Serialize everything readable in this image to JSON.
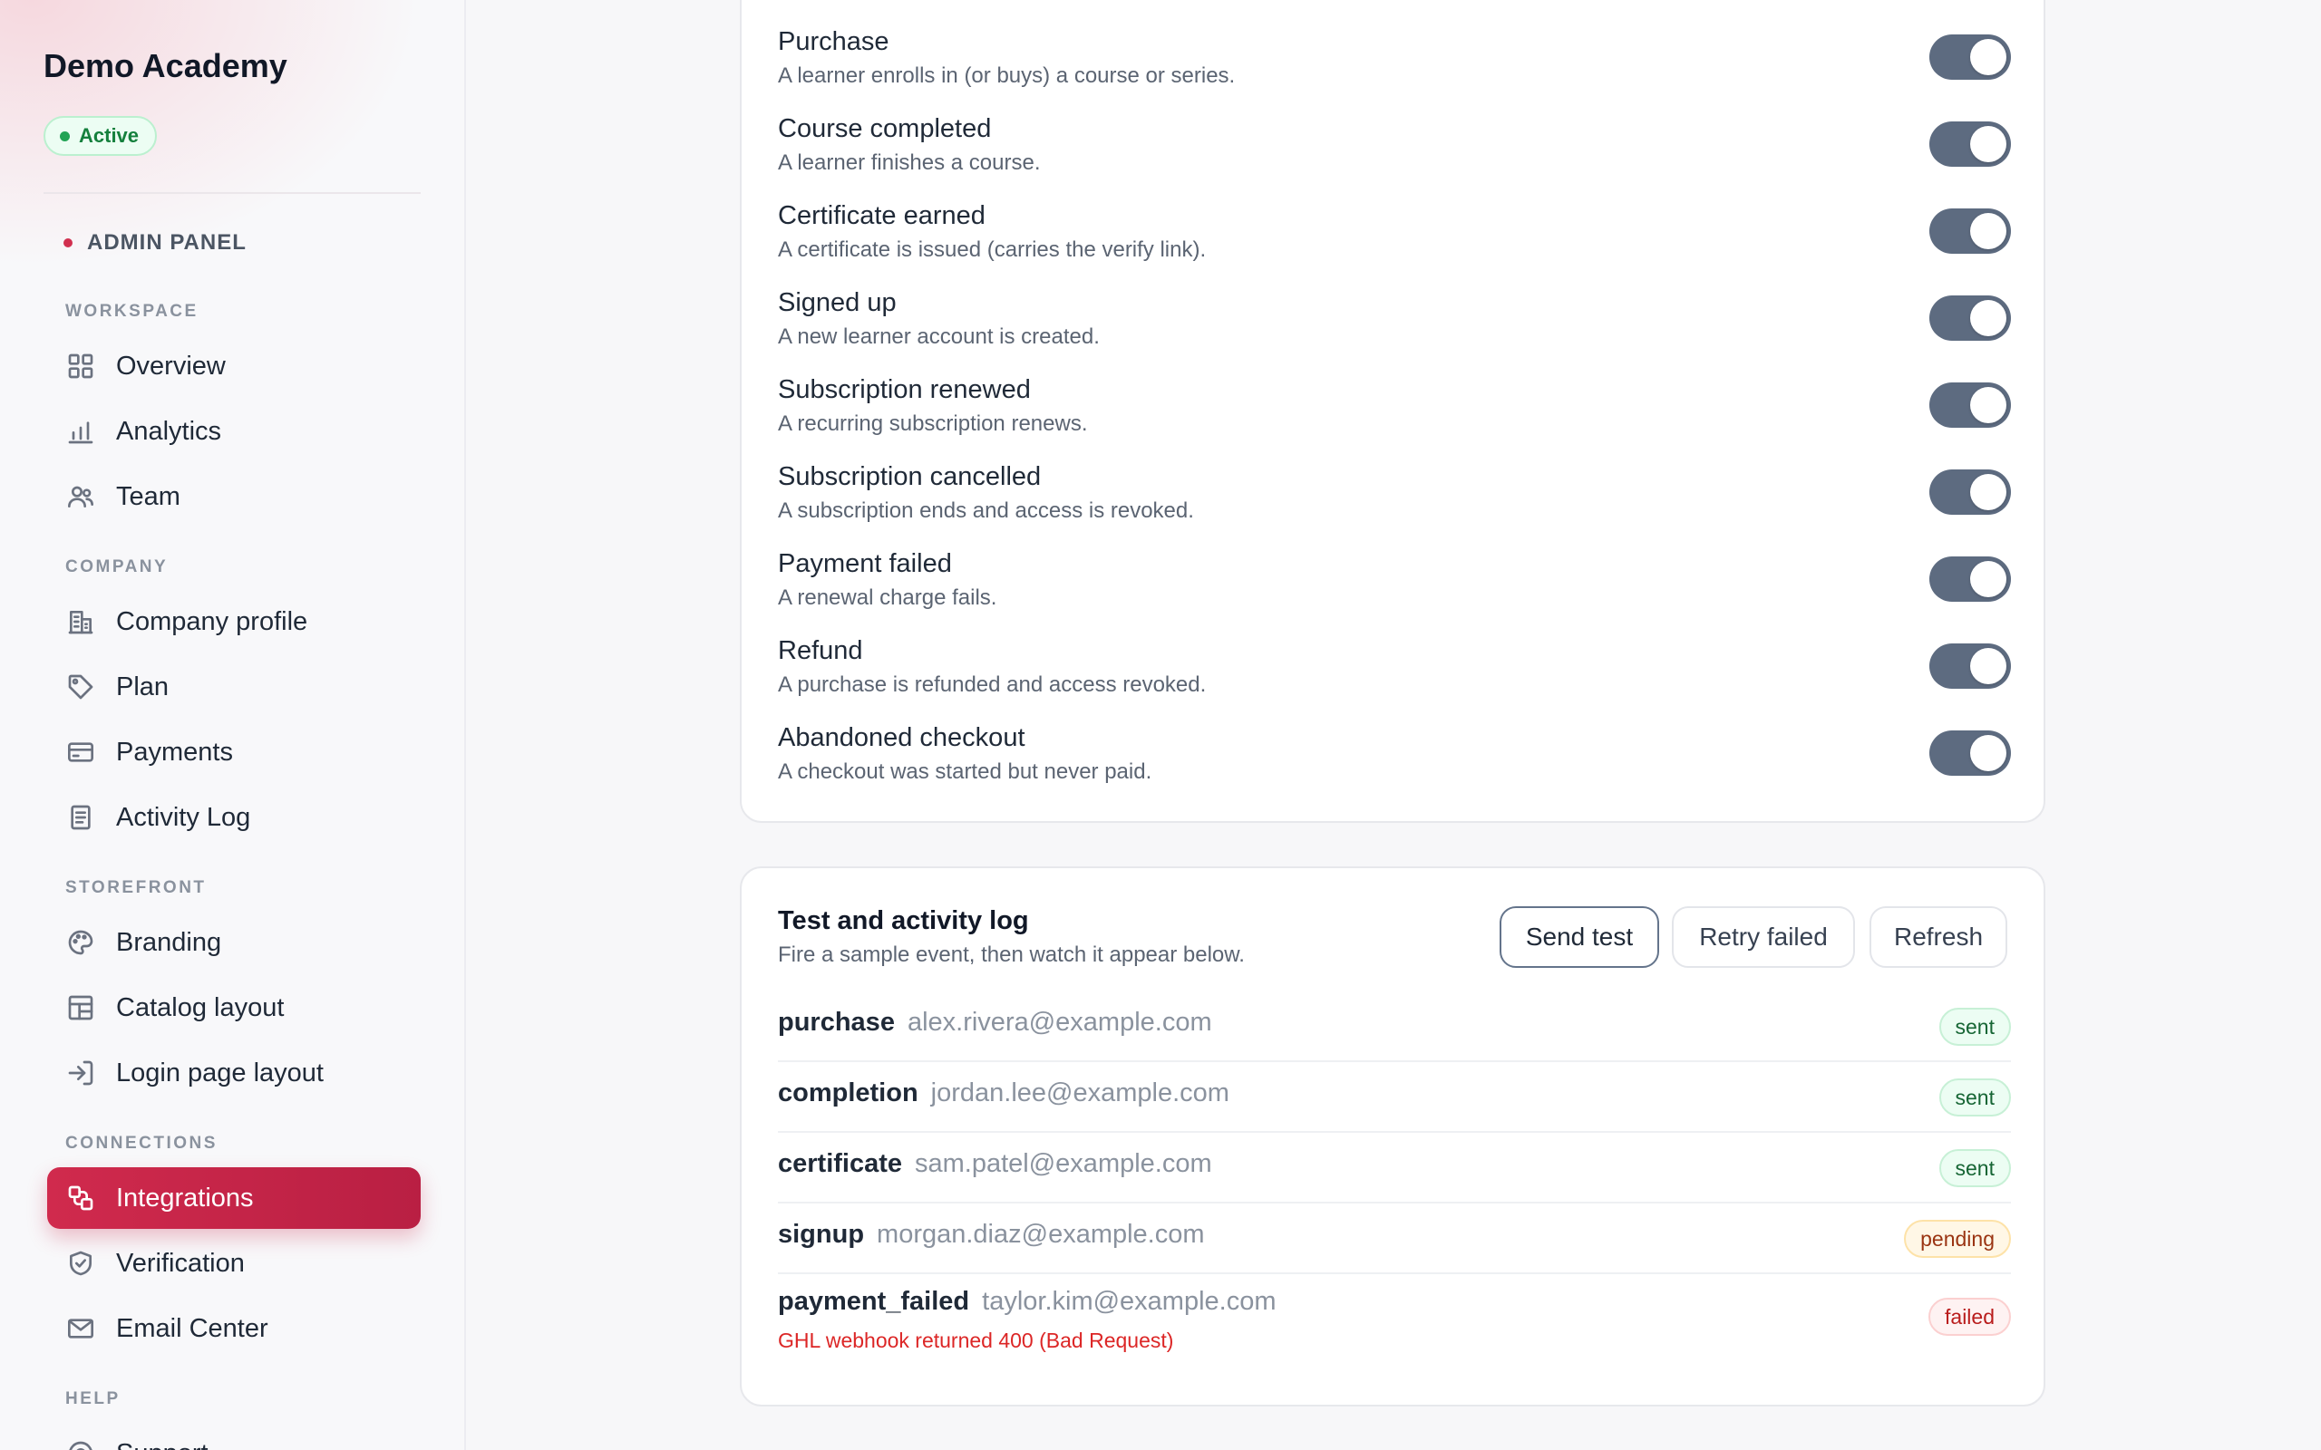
{
  "sidebar": {
    "brand": "Demo Academy",
    "status": "Active",
    "admin_panel": "ADMIN PANEL",
    "sections": {
      "workspace": "WORKSPACE",
      "company": "COMPANY",
      "storefront": "STOREFRONT",
      "connections": "CONNECTIONS",
      "help": "HELP"
    },
    "items": {
      "overview": "Overview",
      "analytics": "Analytics",
      "team": "Team",
      "company_profile": "Company profile",
      "plan": "Plan",
      "payments": "Payments",
      "activity_log": "Activity Log",
      "branding": "Branding",
      "catalog_layout": "Catalog layout",
      "login_page_layout": "Login page layout",
      "integrations": "Integrations",
      "verification": "Verification",
      "email_center": "Email Center",
      "support": "Support"
    },
    "active_item": "Integrations"
  },
  "events": [
    {
      "title": "Purchase",
      "desc": "A learner enrolls in (or buys) a course or series.",
      "enabled": true
    },
    {
      "title": "Course completed",
      "desc": "A learner finishes a course.",
      "enabled": true
    },
    {
      "title": "Certificate earned",
      "desc": "A certificate is issued (carries the verify link).",
      "enabled": true
    },
    {
      "title": "Signed up",
      "desc": "A new learner account is created.",
      "enabled": true
    },
    {
      "title": "Subscription renewed",
      "desc": "A recurring subscription renews.",
      "enabled": true
    },
    {
      "title": "Subscription cancelled",
      "desc": "A subscription ends and access is revoked.",
      "enabled": true
    },
    {
      "title": "Payment failed",
      "desc": "A renewal charge fails.",
      "enabled": true
    },
    {
      "title": "Refund",
      "desc": "A purchase is refunded and access revoked.",
      "enabled": true
    },
    {
      "title": "Abandoned checkout",
      "desc": "A checkout was started but never paid.",
      "enabled": true
    }
  ],
  "log": {
    "title": "Test and activity log",
    "subtitle": "Fire a sample event, then watch it appear below.",
    "buttons": {
      "send_test": "Send test",
      "retry_failed": "Retry failed",
      "refresh": "Refresh"
    },
    "entries": [
      {
        "event": "purchase",
        "email": "alex.rivera@example.com",
        "status": "sent"
      },
      {
        "event": "completion",
        "email": "jordan.lee@example.com",
        "status": "sent"
      },
      {
        "event": "certificate",
        "email": "sam.patel@example.com",
        "status": "sent"
      },
      {
        "event": "signup",
        "email": "morgan.diaz@example.com",
        "status": "pending"
      },
      {
        "event": "payment_failed",
        "email": "taylor.kim@example.com",
        "status": "failed",
        "error": "GHL webhook returned 400 (Bad Request)"
      }
    ]
  },
  "colors": {
    "accent": "#c8284b",
    "toggle_on": "#5d6b80",
    "status_sent": "#166534",
    "status_pending": "#9a3412",
    "status_failed": "#b91c1c"
  }
}
